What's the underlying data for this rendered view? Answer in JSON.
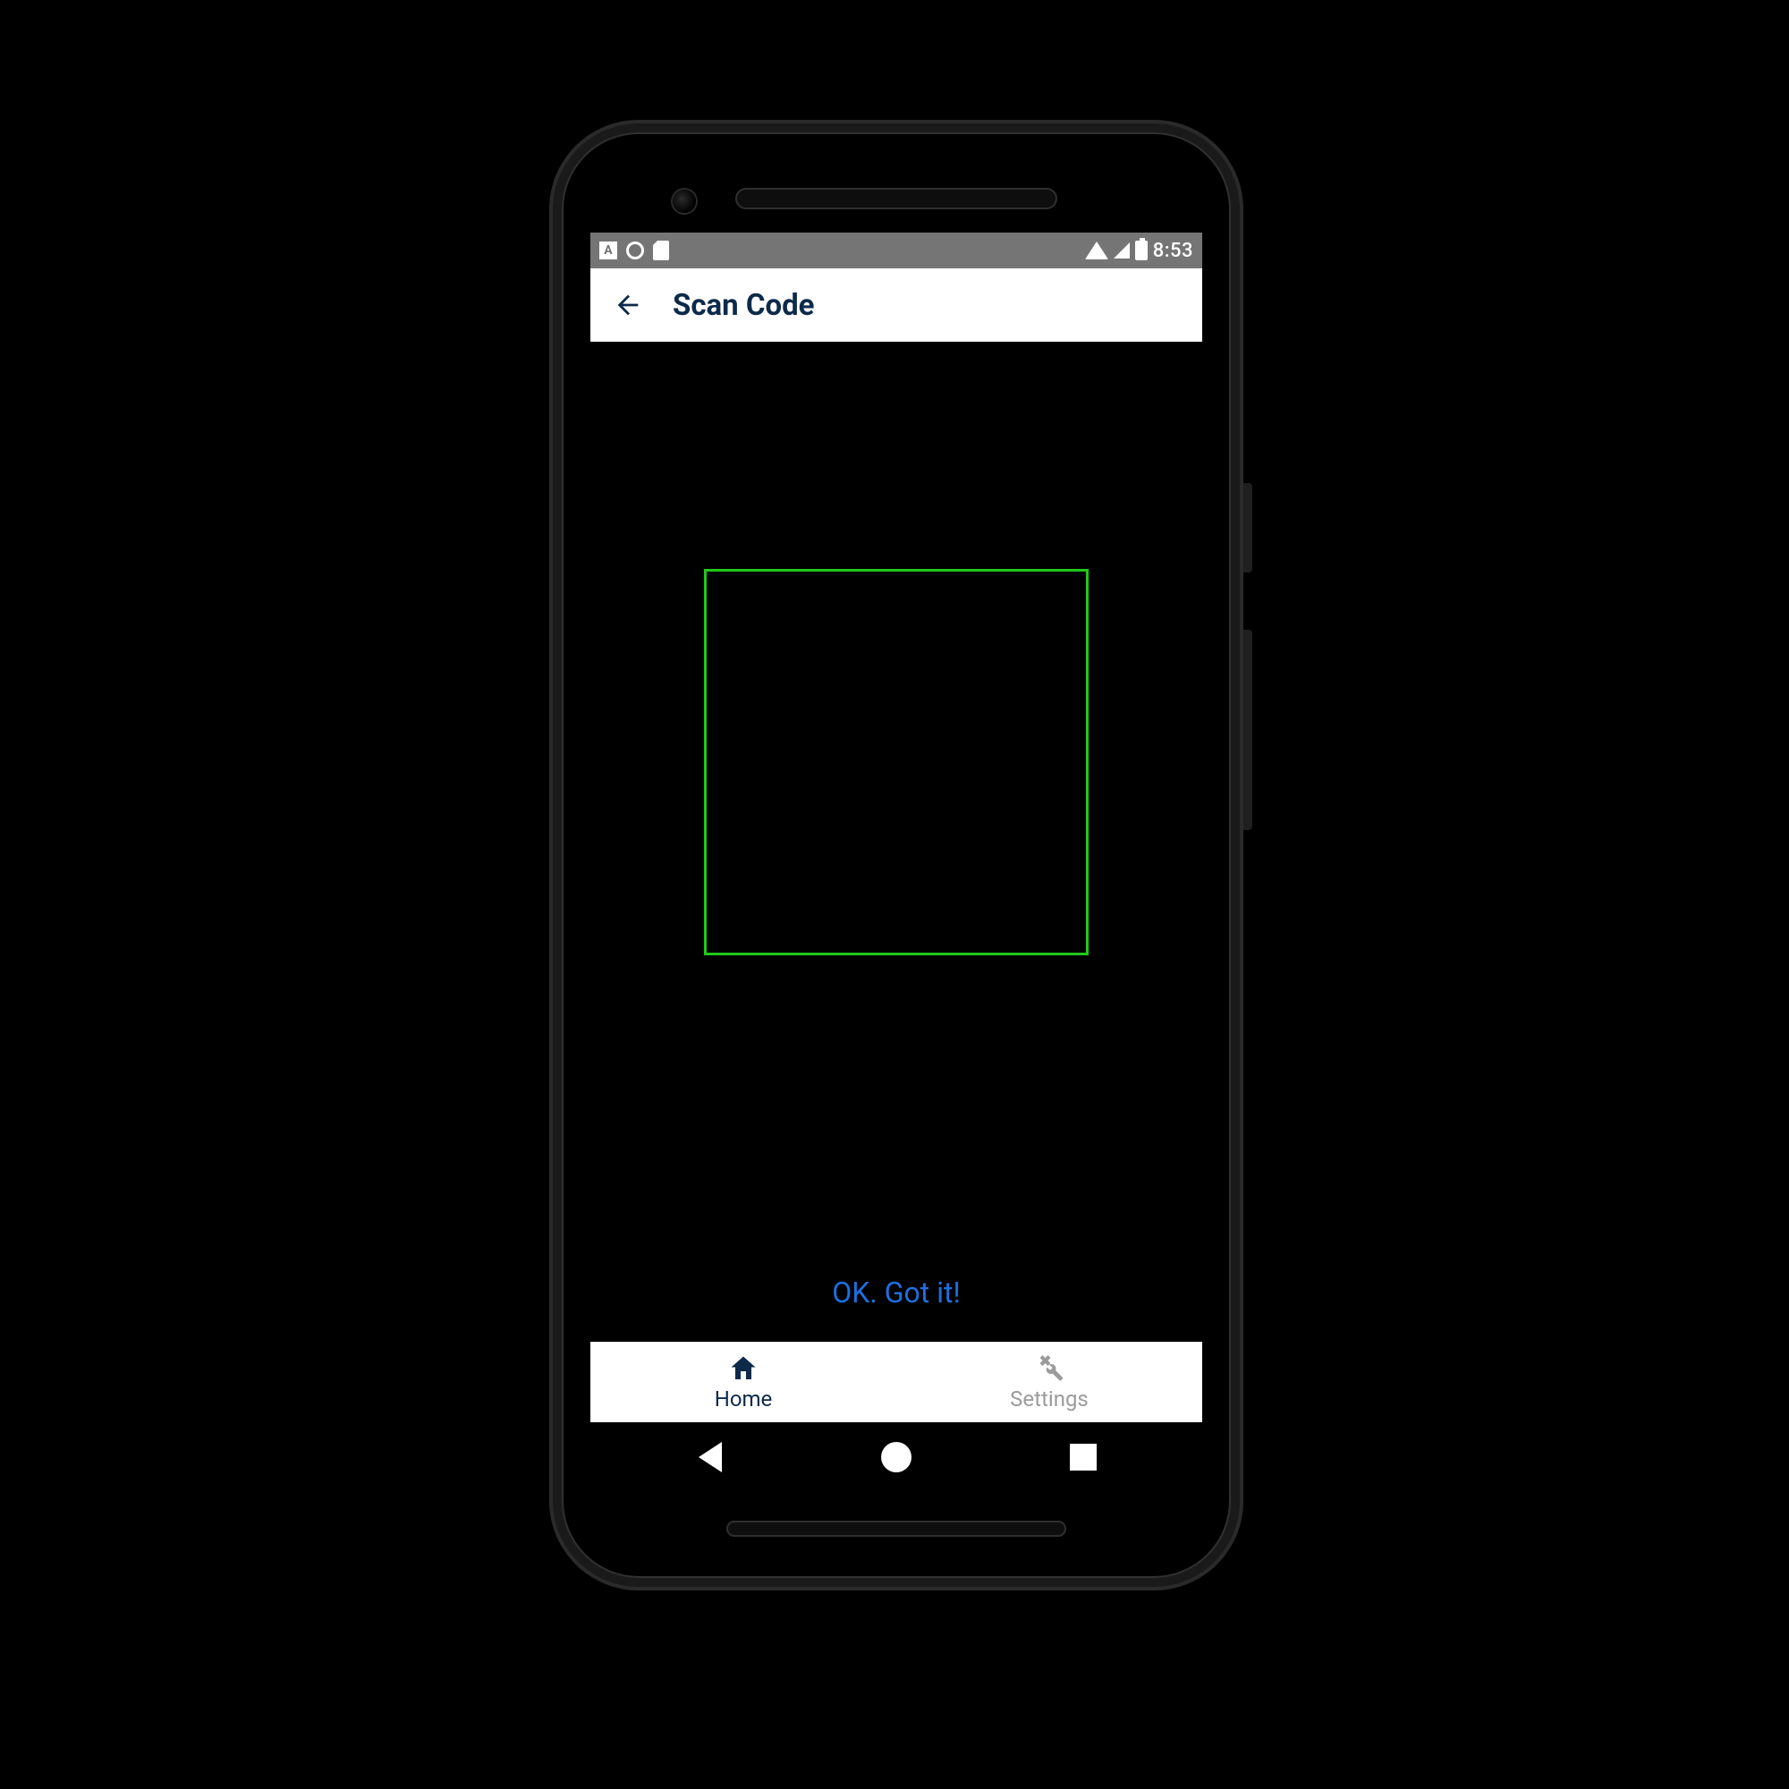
{
  "status_bar": {
    "time": "8:53",
    "icons": {
      "left_badge": "A",
      "ring": "ring-icon",
      "sd": "sd-icon"
    }
  },
  "app_bar": {
    "back_aria": "Back",
    "title": "Scan Code"
  },
  "scan": {
    "confirm_label": "OK. Got it!"
  },
  "tabs": {
    "home": {
      "label": "Home",
      "active": true
    },
    "settings": {
      "label": "Settings",
      "active": false
    }
  },
  "android_nav": {
    "back": "Back",
    "home": "Home",
    "recent": "Recent"
  },
  "colors": {
    "brand_dark": "#0d2a4a",
    "link_blue": "#1e6fe0",
    "scan_green": "#22c71a",
    "statusbar_grey": "#757575"
  }
}
